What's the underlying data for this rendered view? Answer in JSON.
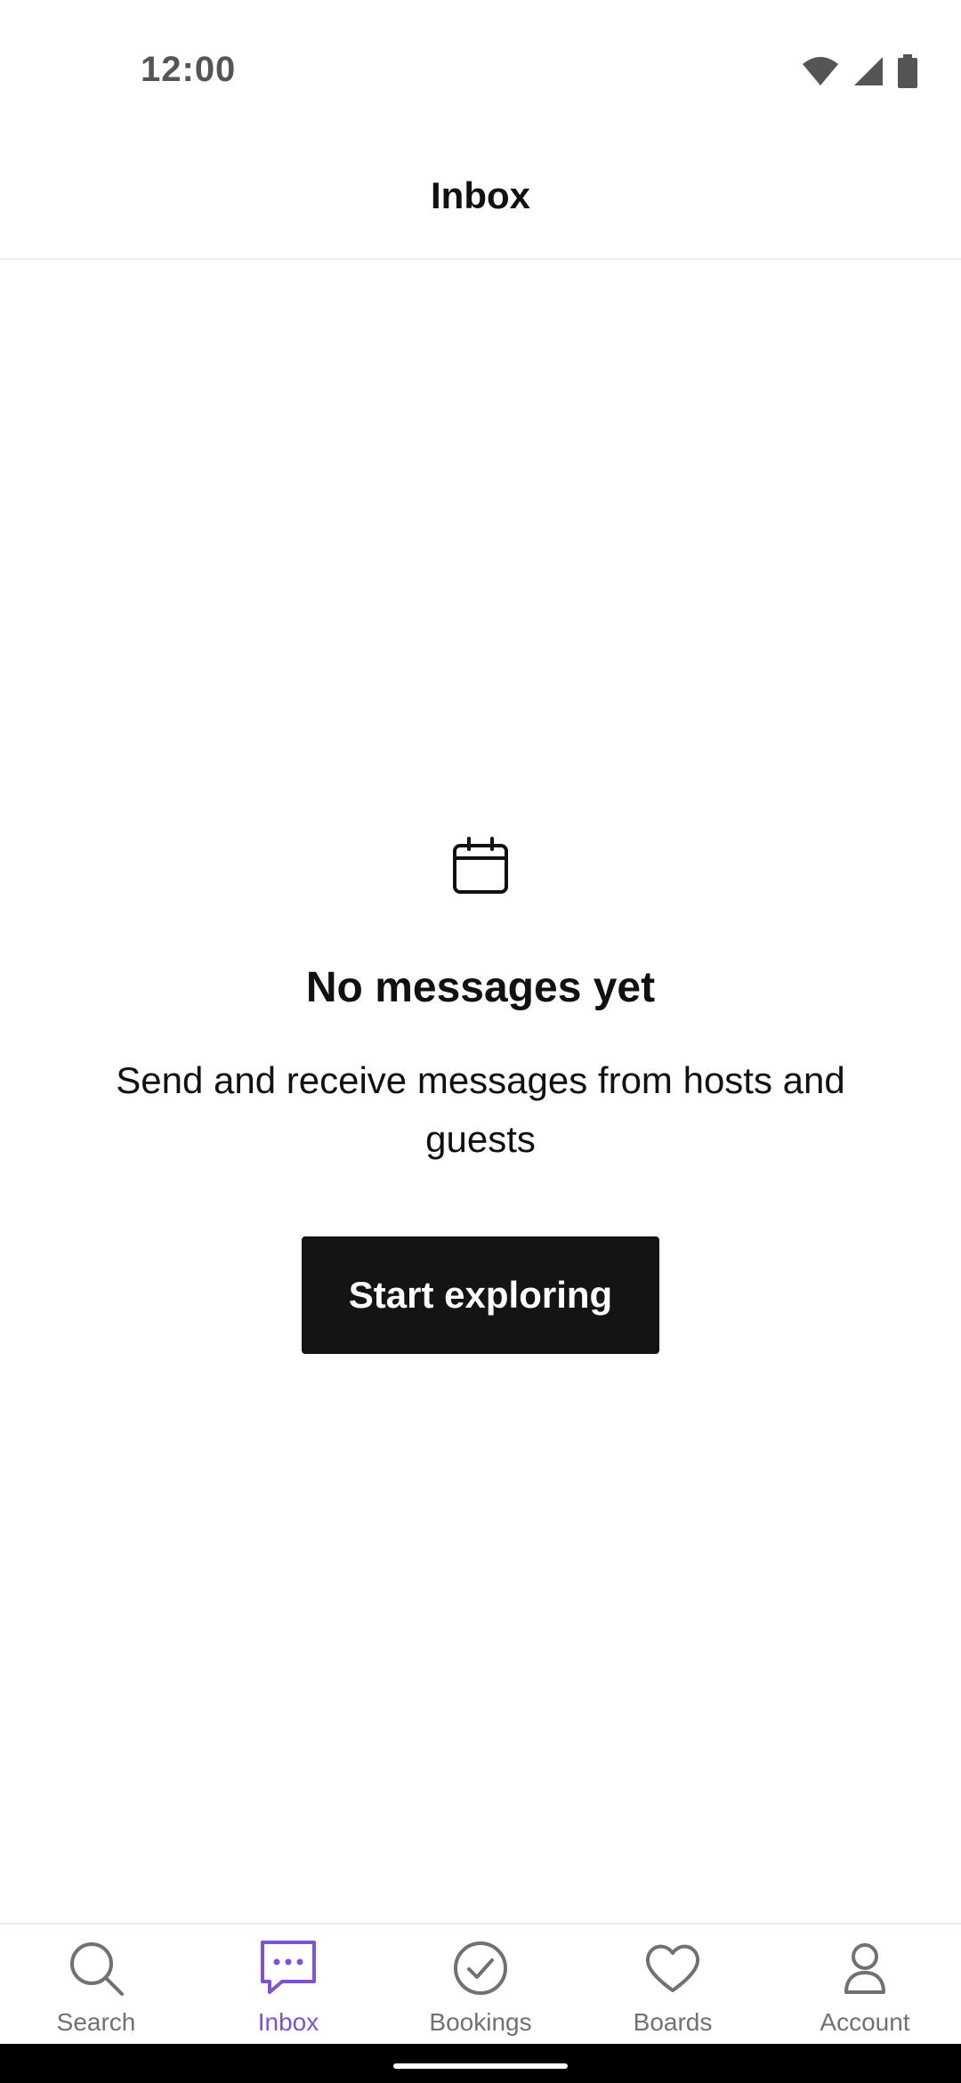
{
  "status_bar": {
    "time": "12:00",
    "icons": [
      "wifi-icon",
      "cell-signal-icon",
      "battery-icon"
    ]
  },
  "header": {
    "title": "Inbox"
  },
  "empty_state": {
    "icon": "calendar-icon",
    "title": "No messages yet",
    "subtitle": "Send and receive messages from hosts and guests",
    "button_label": "Start exploring"
  },
  "bottom_nav": {
    "active": "Inbox",
    "items": [
      {
        "label": "Search",
        "icon": "search-icon"
      },
      {
        "label": "Inbox",
        "icon": "chat-bubble-icon"
      },
      {
        "label": "Bookings",
        "icon": "check-circle-icon"
      },
      {
        "label": "Boards",
        "icon": "heart-icon"
      },
      {
        "label": "Account",
        "icon": "person-icon"
      }
    ]
  },
  "colors": {
    "accent": "#7b52d8",
    "button_bg": "#141414",
    "inactive": "#717171",
    "text": "#111111"
  }
}
